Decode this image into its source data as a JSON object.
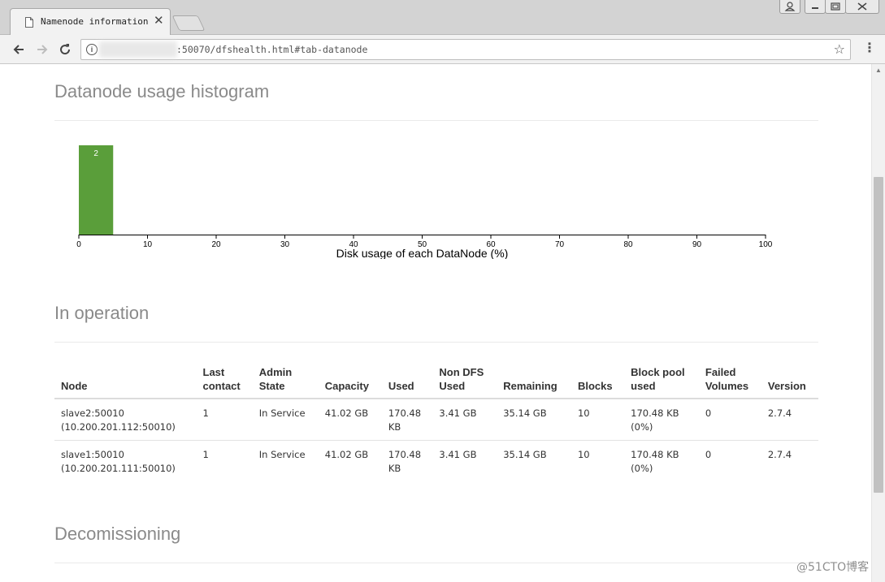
{
  "browser": {
    "tab_title": "Namenode information",
    "tab_close": "✕",
    "url": ":50070/dfshealth.html#tab-datanode",
    "window_buttons": [
      "user",
      "minimize",
      "restore",
      "close"
    ]
  },
  "sections": {
    "histogram_title": "Datanode usage histogram",
    "operation_title": "In operation",
    "decommissioning_title": "Decomissioning"
  },
  "chart_data": {
    "type": "bar",
    "title": "",
    "xlabel": "Disk usage of each DataNode (%)",
    "ylabel": "",
    "xlim": [
      0,
      100
    ],
    "xticks": [
      0,
      10,
      20,
      30,
      40,
      50,
      60,
      70,
      80,
      90,
      100
    ],
    "bins": [
      {
        "range": [
          0,
          5
        ],
        "count": 2,
        "label": "2"
      }
    ],
    "bar_color": "#5a9e3a",
    "grid": false
  },
  "table": {
    "headers": [
      [
        "Node"
      ],
      [
        "Last",
        "contact"
      ],
      [
        "Admin",
        "State"
      ],
      [
        "Capacity"
      ],
      [
        "Used"
      ],
      [
        "Non DFS",
        "Used"
      ],
      [
        "Remaining"
      ],
      [
        "Blocks"
      ],
      [
        "Block pool",
        "used"
      ],
      [
        "Failed",
        "Volumes"
      ],
      [
        "Version"
      ]
    ],
    "rows": [
      [
        [
          "slave2:50010",
          "(10.200.201.112:50010)"
        ],
        [
          "1"
        ],
        [
          "In Service"
        ],
        [
          "41.02 GB"
        ],
        [
          "170.48",
          "KB"
        ],
        [
          "3.41 GB"
        ],
        [
          "35.14 GB"
        ],
        [
          "10"
        ],
        [
          "170.48 KB",
          "(0%)"
        ],
        [
          "0"
        ],
        [
          "2.7.4"
        ]
      ],
      [
        [
          "slave1:50010",
          "(10.200.201.111:50010)"
        ],
        [
          "1"
        ],
        [
          "In Service"
        ],
        [
          "41.02 GB"
        ],
        [
          "170.48",
          "KB"
        ],
        [
          "3.41 GB"
        ],
        [
          "35.14 GB"
        ],
        [
          "10"
        ],
        [
          "170.48 KB",
          "(0%)"
        ],
        [
          "0"
        ],
        [
          "2.7.4"
        ]
      ]
    ]
  },
  "watermark": "@51CTO博客"
}
